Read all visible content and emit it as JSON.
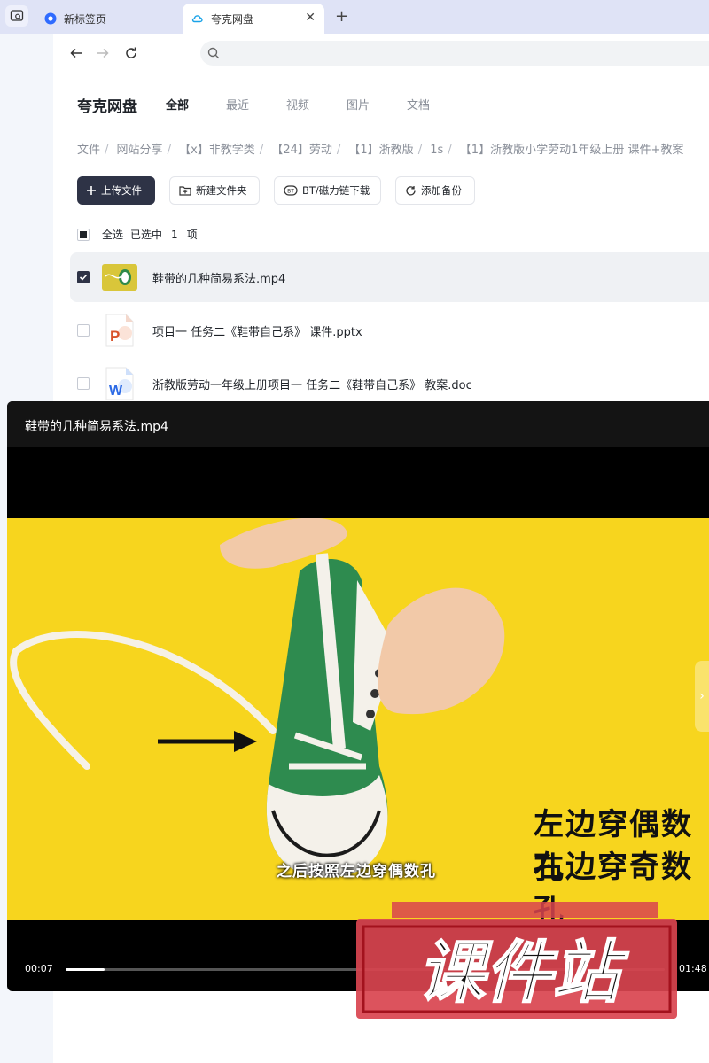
{
  "browser": {
    "tabs": [
      {
        "label": "新标签页",
        "active": false
      },
      {
        "label": "夸克网盘",
        "active": true
      }
    ],
    "address": ""
  },
  "app": {
    "brand": "夸克网盘",
    "nav": [
      "全部",
      "最近",
      "视频",
      "图片",
      "文档"
    ],
    "active_nav": "全部",
    "breadcrumb": [
      "文件",
      "网站分享",
      "【x】非教学类",
      "【24】劳动",
      "【1】浙教版",
      "1s",
      "【1】浙教版小学劳动1年级上册 课件+教案"
    ],
    "toolbar": {
      "upload": "上传文件",
      "new_folder": "新建文件夹",
      "bt": "BT/磁力链下载",
      "backup": "添加备份"
    },
    "selection": {
      "select_all": "全选",
      "selected_text": "已选中",
      "count": "1",
      "unit": "项"
    },
    "files": [
      {
        "name": "鞋带的几种简易系法.mp4",
        "type": "video",
        "checked": true
      },
      {
        "name": "项目一 任务二《鞋带自己系》 课件.pptx",
        "type": "pptx",
        "checked": false
      },
      {
        "name": "浙教版劳动一年级上册项目一 任务二《鞋带自己系》 教案.doc",
        "type": "doc",
        "checked": false
      }
    ]
  },
  "player": {
    "title": "鞋带的几种简易系法.mp4",
    "subtitle": "之后按照左边穿偶数孔",
    "overlay_line1": "左边穿偶数孔",
    "overlay_line2": "右边穿奇数孔",
    "current_time": "00:07",
    "duration": "01:48",
    "progress": 0.065
  },
  "watermark": {
    "text": "课件站"
  }
}
